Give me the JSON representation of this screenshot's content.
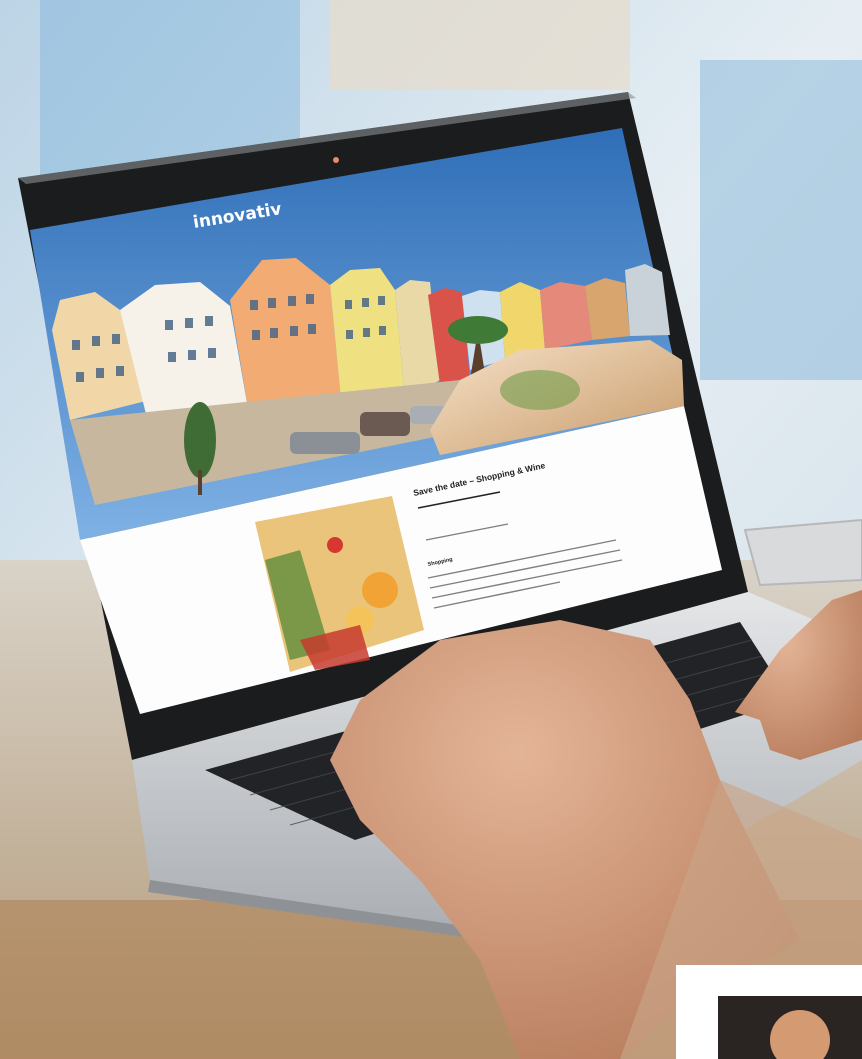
{
  "website": {
    "logo": "innovativ",
    "tagline": "",
    "nav": [
      "",
      "",
      "",
      ""
    ],
    "article": {
      "title": "Save the date – Shopping & Wine",
      "date_line": "",
      "section_heading": "Shopping",
      "body_lines": [
        "",
        "",
        "",
        "",
        ""
      ]
    }
  },
  "colors": {
    "sky": "#4f86c9",
    "accent_orange": "#f2a36a",
    "screen_white": "#ffffff",
    "laptop_silver": "#c8ccd0"
  }
}
